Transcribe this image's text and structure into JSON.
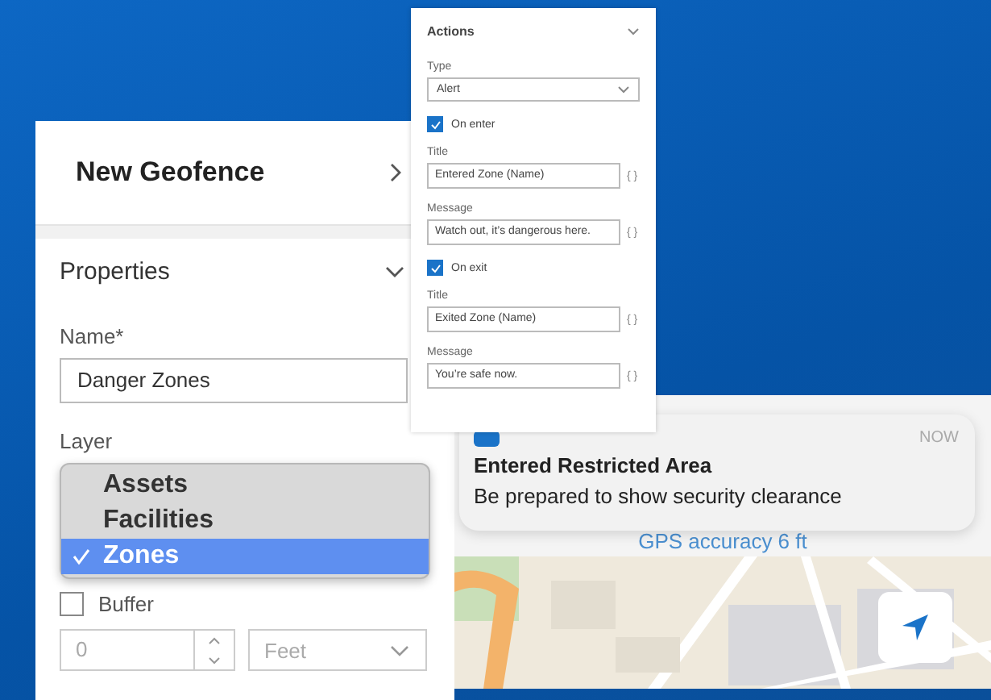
{
  "geofence_panel": {
    "title": "New Geofence",
    "section": "Properties",
    "name_label": "Name*",
    "name_value": "Danger Zones",
    "layer_label": "Layer",
    "layer_options": [
      {
        "label": "Assets",
        "selected": false
      },
      {
        "label": "Facilities",
        "selected": false
      },
      {
        "label": "Zones",
        "selected": true
      }
    ],
    "buffer": {
      "label": "Buffer",
      "checked": false
    },
    "buffer_value": "0",
    "unit": "Feet"
  },
  "actions_panel": {
    "title": "Actions",
    "type_label": "Type",
    "type_value": "Alert",
    "triggers": [
      {
        "label": "On enter",
        "checked": true,
        "title_label": "Title",
        "title_value": "Entered Zone (Name)",
        "title_token": "{ }",
        "message_label": "Message",
        "message_value": "Watch out, it’s dangerous here.",
        "message_token": "{ }"
      },
      {
        "label": "On exit",
        "checked": true,
        "title_label": "Title",
        "title_value": "Exited Zone (Name)",
        "title_token": "{ }",
        "message_label": "Message",
        "message_value": "You’re safe now.",
        "message_token": "{ }"
      }
    ]
  },
  "notification": {
    "time": "NOW",
    "title": "Entered Restricted Area",
    "body": "Be prepared to show security clearance"
  },
  "map_panel": {
    "gps_accuracy": "GPS accuracy 6 ft"
  }
}
